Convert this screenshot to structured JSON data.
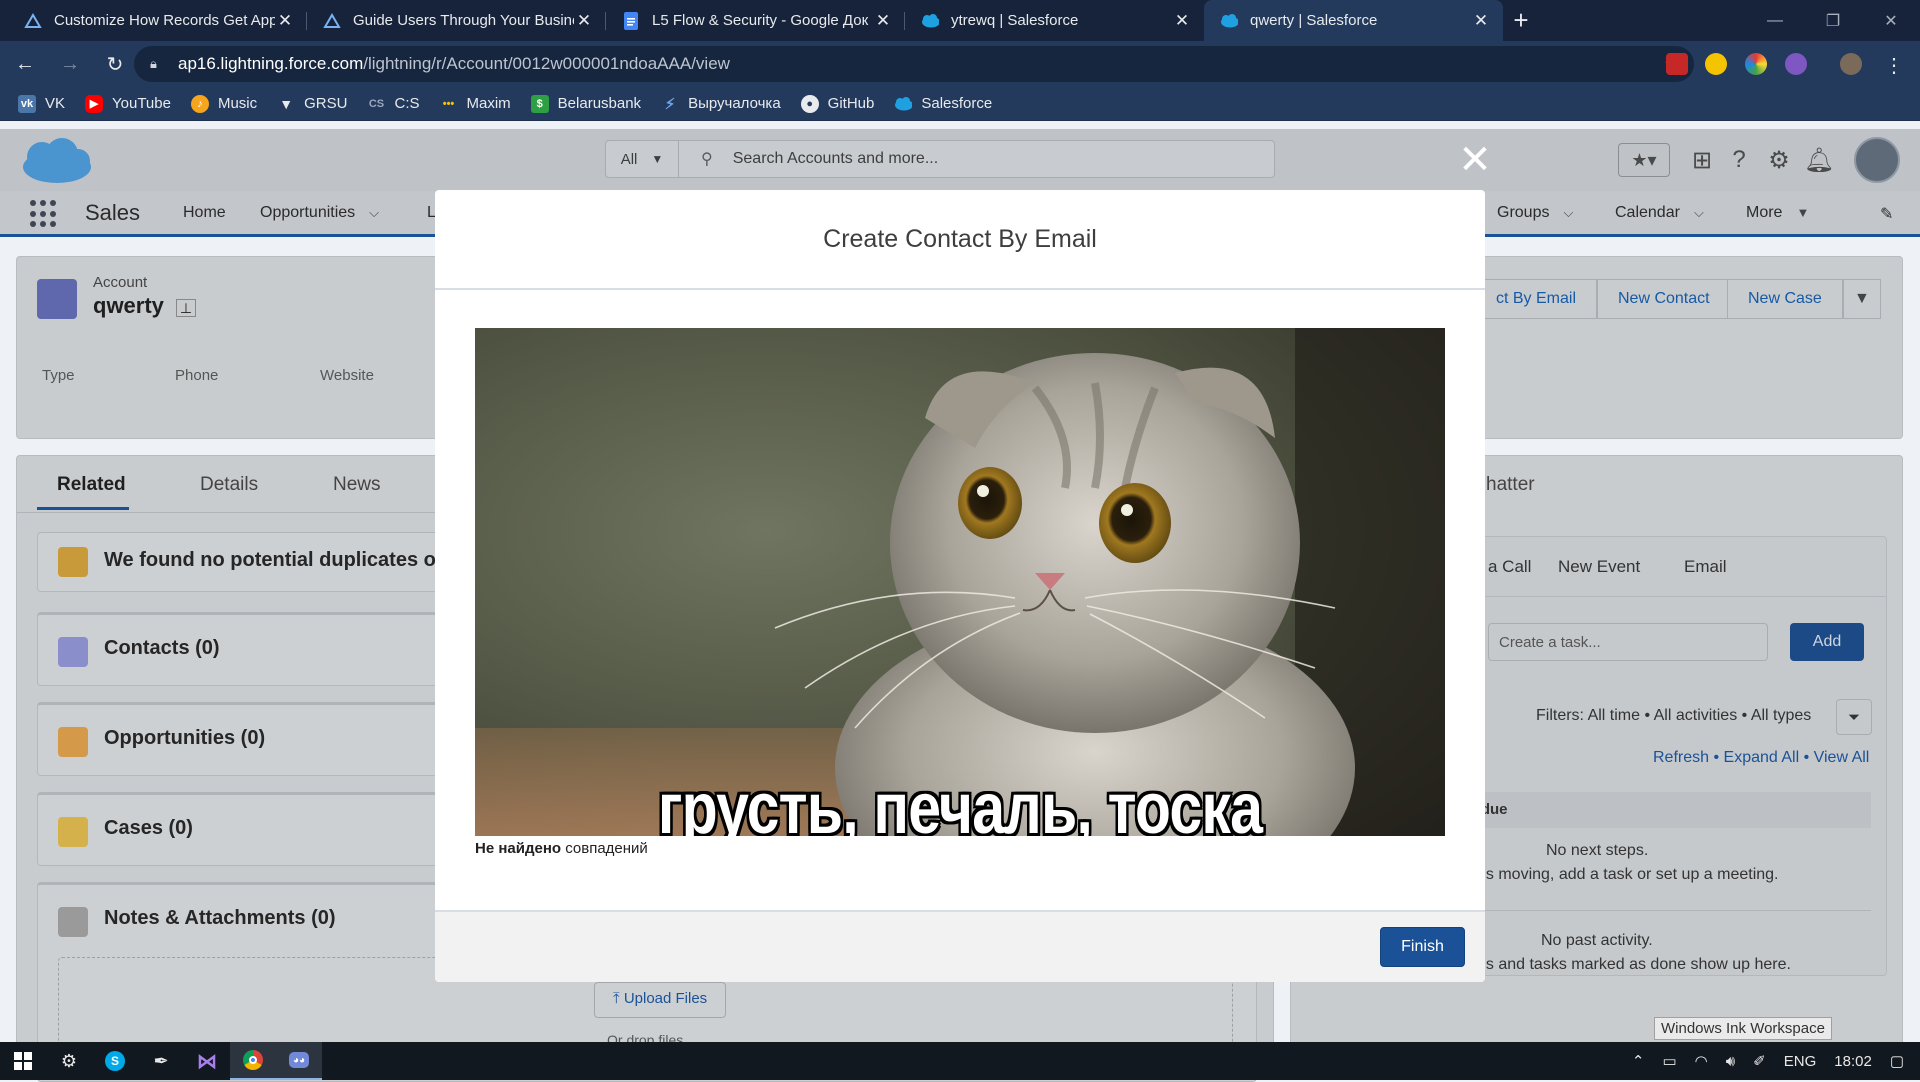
{
  "browser": {
    "tabs": [
      {
        "title": "Customize How Records Get App",
        "icon": "trailhead-icon",
        "active": false
      },
      {
        "title": "Guide Users Through Your Busine",
        "icon": "trailhead-icon",
        "active": false
      },
      {
        "title": "L5 Flow & Security - Google Док",
        "icon": "google-docs-icon",
        "active": false
      },
      {
        "title": "ytrewq | Salesforce",
        "icon": "salesforce-icon",
        "active": false
      },
      {
        "title": "qwerty | Salesforce",
        "icon": "salesforce-icon",
        "active": true
      }
    ],
    "new_tab": "+",
    "url_host": "ap16.lightning.force.com",
    "url_path": "/lightning/r/Account/0012w000001ndoaAAA/view",
    "bookmarks": [
      {
        "label": "VK",
        "icon": "vk-icon",
        "color": "#4a76a8"
      },
      {
        "label": "YouTube",
        "icon": "youtube-icon",
        "color": "#ff0000"
      },
      {
        "label": "Music",
        "icon": "music-icon",
        "color": "#f7a51c"
      },
      {
        "label": "GRSU",
        "icon": "grsu-icon",
        "color": "#e8eaed"
      },
      {
        "label": "C:S",
        "icon": "cs-icon",
        "color": "#233a5c"
      },
      {
        "label": "Maxim",
        "icon": "maxim-icon",
        "color": "#f5c400"
      },
      {
        "label": "Belarusbank",
        "icon": "belarusbank-icon",
        "color": "#2ea043"
      },
      {
        "label": "Выручалочка",
        "icon": "runner-icon",
        "color": "#6aa5e8"
      },
      {
        "label": "GitHub",
        "icon": "github-icon",
        "color": "#e8eaed"
      },
      {
        "label": "Salesforce",
        "icon": "salesforce-icon",
        "color": "#1fa0e0"
      }
    ]
  },
  "sf": {
    "search_scope": "All",
    "search_placeholder": "Search Accounts and more...",
    "app_name": "Sales",
    "nav": [
      "Home",
      "Opportunities",
      "L",
      "Groups",
      "Calendar",
      "More"
    ],
    "record_type": "Account",
    "record_name": "qwerty",
    "fields": [
      "Type",
      "Phone",
      "Website"
    ],
    "header_actions": [
      "ct By Email",
      "New Contact",
      "New Case"
    ],
    "tabs": [
      "Related",
      "Details",
      "News"
    ],
    "duplicates_msg": "We found no potential duplicates o",
    "cards": [
      "Contacts (0)",
      "Opportunities (0)",
      "Cases (0)",
      "Notes & Attachments (0)"
    ],
    "upload_label": "Upload Files",
    "drop_label": "Or drop files",
    "chatter_label": "hatter",
    "activity_actions": [
      "a Call",
      "New Event",
      "Email"
    ],
    "task_placeholder": "Create a task...",
    "add_label": "Add",
    "filters": "Filters: All time • All activities • All types",
    "links": "Refresh • Expand All • View All",
    "overdue": "rdue",
    "no_next": "No next steps.",
    "next_hint": "gs moving, add a task or set up a meeting.",
    "no_past": "No past activity.",
    "past_hint": "gs and tasks marked as done show up here."
  },
  "modal": {
    "title": "Create Contact By Email",
    "caption": "грусть, печаль, тоска",
    "result_bold": "Не найдено",
    "result_rest": " совпадений",
    "finish": "Finish"
  },
  "status_tooltip": "Windows Ink Workspace",
  "taskbar": {
    "lang": "ENG",
    "time": "18:02"
  },
  "colors": {
    "sf_blue": "#1b5297",
    "chrome_dark": "#16233a",
    "chrome_toolbar": "#233a5c"
  }
}
